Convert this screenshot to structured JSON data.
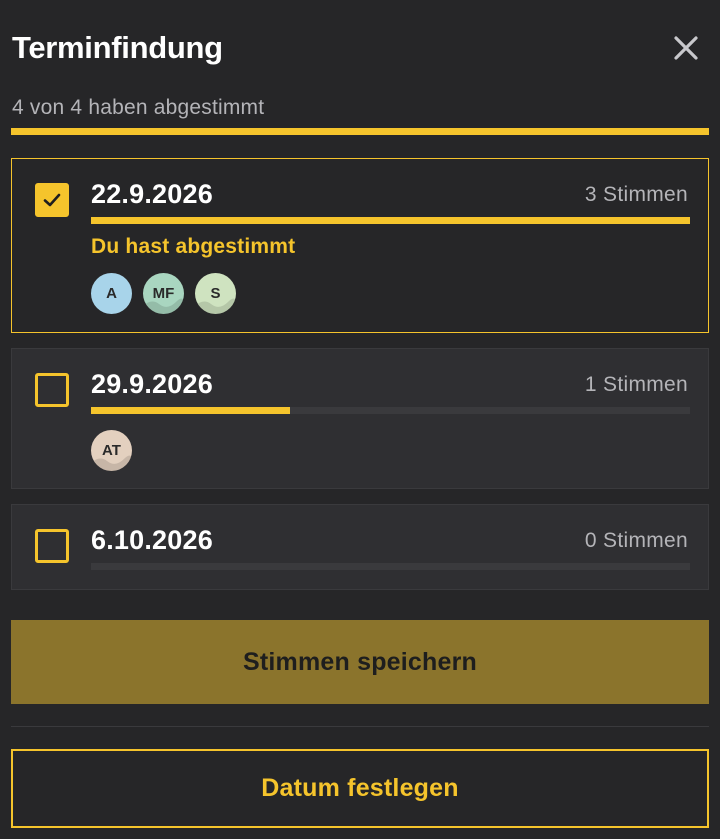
{
  "header": {
    "title": "Terminfindung",
    "close_icon": "close-icon"
  },
  "progress": {
    "label": "4 von 4 haben abgestimmt",
    "voted": 4,
    "total": 4,
    "fraction": 1.0
  },
  "options": [
    {
      "date": "22.9.2026",
      "votes_label": "3 Stimmen",
      "vote_fraction": 1.0,
      "checked": true,
      "voted_text": "Du hast abgestimmt",
      "avatars": [
        {
          "initials": "A",
          "color": "#a8d4ea",
          "pattern": false
        },
        {
          "initials": "MF",
          "color": "#a9d6c0",
          "pattern": true
        },
        {
          "initials": "S",
          "color": "#cfe3c0",
          "pattern": true
        }
      ]
    },
    {
      "date": "29.9.2026",
      "votes_label": "1 Stimmen",
      "vote_fraction": 0.333,
      "checked": false,
      "avatars": [
        {
          "initials": "AT",
          "color": "#e3d0bf",
          "pattern": true
        }
      ]
    },
    {
      "date": "6.10.2026",
      "votes_label": "0 Stimmen",
      "vote_fraction": 0,
      "checked": false,
      "avatars": []
    }
  ],
  "actions": {
    "save_label": "Stimmen speichern",
    "fix_date_label": "Datum festlegen"
  },
  "colors": {
    "background": "#262628",
    "accent": "#f5c42c",
    "save_button": "#8b742c",
    "card": "#2f2f32",
    "muted_text": "#b4b4b8"
  }
}
